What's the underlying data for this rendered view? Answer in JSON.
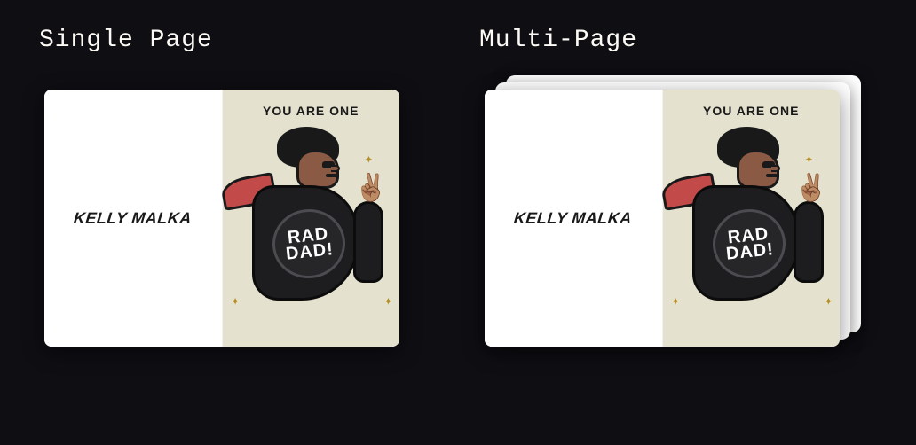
{
  "options": {
    "single": {
      "title": "Single Page"
    },
    "multi": {
      "title": "Multi-Page"
    }
  },
  "card": {
    "artist": "KELLY MALKA",
    "headline": "YOU ARE ONE",
    "patch_line1": "RAD",
    "patch_line2": "DAD!",
    "hand_emoji": "✌🏽",
    "spark": "✦"
  },
  "colors": {
    "bg": "#0e0e13",
    "paper": "#ffffff",
    "cream": "#e4e2ce",
    "ink": "#19191a",
    "scarf": "#c24b49",
    "skin": "#8a5a44"
  }
}
